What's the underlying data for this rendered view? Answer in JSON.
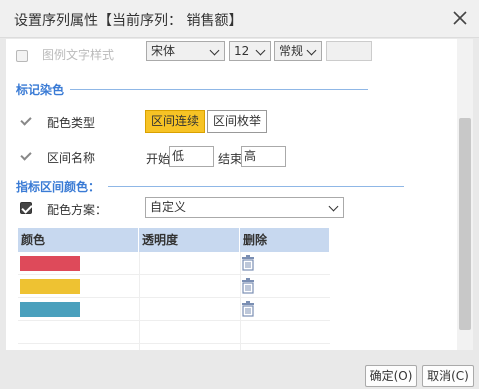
{
  "dialog": {
    "title": "设置序列属性【当前序列： 销售额】"
  },
  "legend_style": {
    "label": "图例文字样式",
    "font_family": "宋体",
    "font_size": "12",
    "font_weight": "常规"
  },
  "marker_color": {
    "section_title": "标记染色",
    "color_type_label": "配色类型",
    "btn_interval_continuous": "区间连续",
    "btn_interval_enum": "区间枚举",
    "interval_name_label": "区间名称",
    "start_label": "开始",
    "start_value": "低",
    "end_label": "结束",
    "end_value": "高"
  },
  "indicator_color": {
    "section_title": "指标区间颜色：",
    "scheme_label": "配色方案：",
    "scheme_value": "自定义"
  },
  "table": {
    "headers": [
      "颜色",
      "透明度",
      "删除"
    ],
    "rows": [
      {
        "color": "#de4a5a"
      },
      {
        "color": "#eec232"
      },
      {
        "color": "#4aa0bd"
      }
    ]
  },
  "footer": {
    "ok": "确定(O)",
    "cancel": "取消(C)"
  },
  "colors": {
    "accent": "#3a7bd5",
    "active_button": "#f7c325",
    "header_bg": "#c7d8ef"
  }
}
